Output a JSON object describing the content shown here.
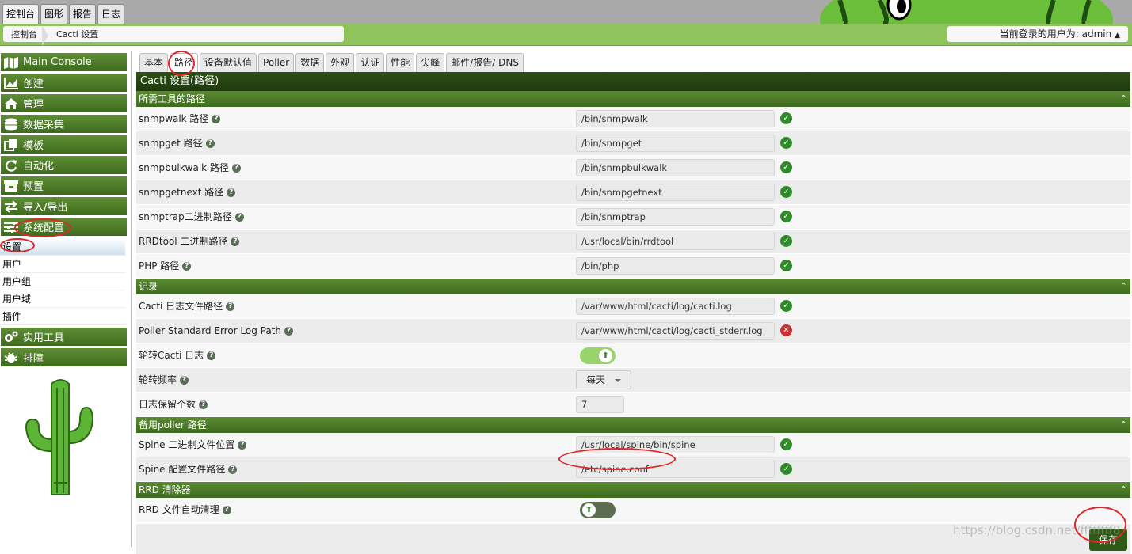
{
  "top_tabs": [
    "控制台",
    "图形",
    "报告",
    "日志"
  ],
  "breadcrumb": [
    "控制台",
    "Cacti 设置"
  ],
  "user": {
    "label": "当前登录的用户为: admin"
  },
  "sidebar": {
    "items": [
      {
        "label": "Main Console",
        "icon": "map-icon"
      },
      {
        "label": "创建",
        "icon": "chart-icon"
      },
      {
        "label": "管理",
        "icon": "home-icon"
      },
      {
        "label": "数据采集",
        "icon": "database-icon"
      },
      {
        "label": "模板",
        "icon": "copy-icon"
      },
      {
        "label": "自动化",
        "icon": "refresh-icon"
      },
      {
        "label": "预置",
        "icon": "archive-icon"
      },
      {
        "label": "导入/导出",
        "icon": "exchange-icon"
      },
      {
        "label": "系统配置",
        "icon": "sliders-icon"
      }
    ],
    "subitems": [
      "设置",
      "用户",
      "用户组",
      "用户域",
      "插件"
    ],
    "items2": [
      {
        "label": "实用工具",
        "icon": "gears-icon"
      },
      {
        "label": "排障",
        "icon": "bug-icon"
      }
    ]
  },
  "tabs": [
    "基本",
    "路径",
    "设备默认值",
    "Poller",
    "数据",
    "外观",
    "认证",
    "性能",
    "尖峰",
    "邮件/报告/ DNS"
  ],
  "panel_title": "Cacti 设置(路径)",
  "sections": [
    {
      "title": "所需工具的路径",
      "rows": [
        {
          "label": "snmpwalk 路径",
          "value": "/bin/snmpwalk",
          "status": "ok"
        },
        {
          "label": "snmpget 路径",
          "value": "/bin/snmpget",
          "status": "ok"
        },
        {
          "label": "snmpbulkwalk 路径",
          "value": "/bin/snmpbulkwalk",
          "status": "ok"
        },
        {
          "label": "snmpgetnext 路径",
          "value": "/bin/snmpgetnext",
          "status": "ok"
        },
        {
          "label": "snmptrap二进制路径",
          "value": "/bin/snmptrap",
          "status": "ok"
        },
        {
          "label": "RRDtool 二进制路径",
          "value": "/usr/local/bin/rrdtool",
          "status": "ok"
        },
        {
          "label": "PHP 路径",
          "value": "/bin/php",
          "status": "ok"
        }
      ]
    },
    {
      "title": "记录",
      "rows": [
        {
          "label": "Cacti 日志文件路径",
          "value": "/var/www/html/cacti/log/cacti.log",
          "status": "ok"
        },
        {
          "label": "Poller Standard Error Log Path",
          "value": "/var/www/html/cacti/log/cacti_stderr.log",
          "status": "error"
        },
        {
          "label": "轮转Cacti 日志",
          "toggle": "on"
        },
        {
          "label": "轮转频率",
          "select": "每天"
        },
        {
          "label": "日志保留个数",
          "short": "7"
        }
      ]
    },
    {
      "title": "备用poller 路径",
      "rows": [
        {
          "label": "Spine 二进制文件位置",
          "value": "/usr/local/spine/bin/spine",
          "status": "ok"
        },
        {
          "label": "Spine 配置文件路径",
          "value": "/etc/spine.conf",
          "status": "ok"
        }
      ]
    },
    {
      "title": "RRD 清除器",
      "rows": [
        {
          "label": "RRD 文件自动清理",
          "toggle": "off"
        }
      ]
    }
  ],
  "save_label": "保存",
  "watermark": "https://blog.csdn.net/ffffffff8",
  "colors": {
    "accent": "#4a7a25",
    "header": "#2d4f16",
    "ok": "#2f8a2a",
    "error": "#d12f2f"
  }
}
